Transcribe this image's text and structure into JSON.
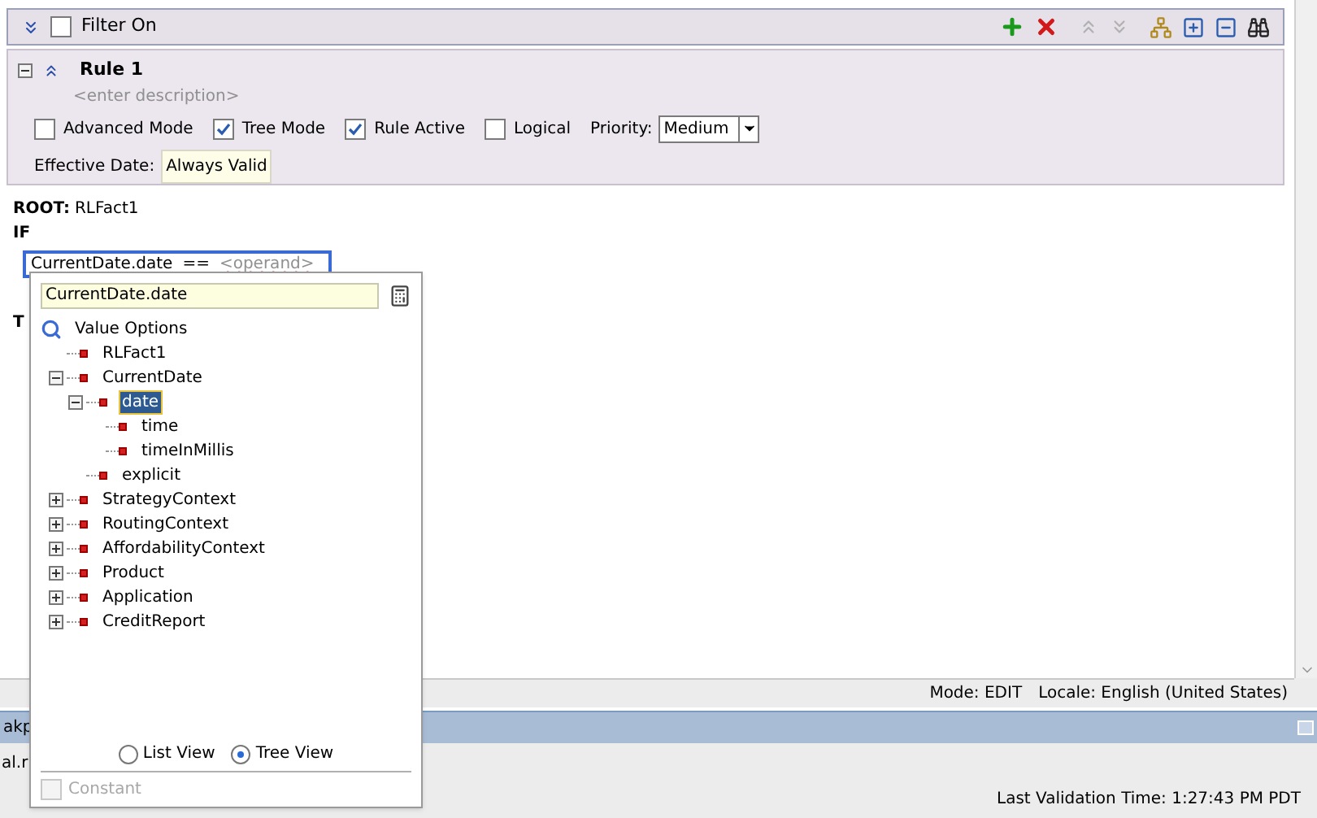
{
  "filter_bar": {
    "label": "Filter On",
    "checked": false
  },
  "rule": {
    "title": "Rule 1",
    "description": "<enter description>",
    "expanded": true,
    "options": [
      {
        "label": "Advanced Mode",
        "checked": false
      },
      {
        "label": "Tree Mode",
        "checked": true
      },
      {
        "label": "Rule Active",
        "checked": true
      },
      {
        "label": "Logical",
        "checked": false
      }
    ],
    "priority": {
      "label": "Priority:",
      "value": "Medium"
    },
    "effective_date": {
      "label": "Effective Date:",
      "value": "Always Valid"
    }
  },
  "editor": {
    "root_label": "ROOT:",
    "root_value": "RLFact1",
    "if_label": "IF",
    "condition": {
      "left": "CurrentDate.date",
      "operator": "==",
      "operand_placeholder": "<operand>"
    },
    "then_label": "T"
  },
  "popup": {
    "field_value": "CurrentDate.date",
    "tree_title": "Value Options",
    "tree": [
      {
        "label": "RLFact1",
        "selected": false
      },
      {
        "label": "CurrentDate",
        "selected": false,
        "expanded": true,
        "children": [
          {
            "label": "date",
            "selected": true,
            "expanded": true,
            "children": [
              {
                "label": "time",
                "selected": false
              },
              {
                "label": "timeInMillis",
                "selected": false
              }
            ]
          },
          {
            "label": "explicit",
            "selected": false
          }
        ]
      },
      {
        "label": "StrategyContext",
        "selected": false,
        "expanded": false
      },
      {
        "label": "RoutingContext",
        "selected": false,
        "expanded": false
      },
      {
        "label": "AffordabilityContext",
        "selected": false,
        "expanded": false
      },
      {
        "label": "Product",
        "selected": false,
        "expanded": false
      },
      {
        "label": "Application",
        "selected": false,
        "expanded": false
      },
      {
        "label": "CreditReport",
        "selected": false,
        "expanded": false
      }
    ],
    "views": [
      {
        "label": "List View",
        "selected": false
      },
      {
        "label": "Tree View",
        "selected": true
      }
    ],
    "constant": {
      "label": "Constant",
      "checked": false,
      "disabled": true
    }
  },
  "status_bar": {
    "mode": "Mode: EDIT",
    "locale": "Locale: English (United States)"
  },
  "bottom_panel": {
    "title": "akp",
    "row_text": "al.r",
    "validation": "Last Validation Time: 1:27:43 PM PDT"
  }
}
